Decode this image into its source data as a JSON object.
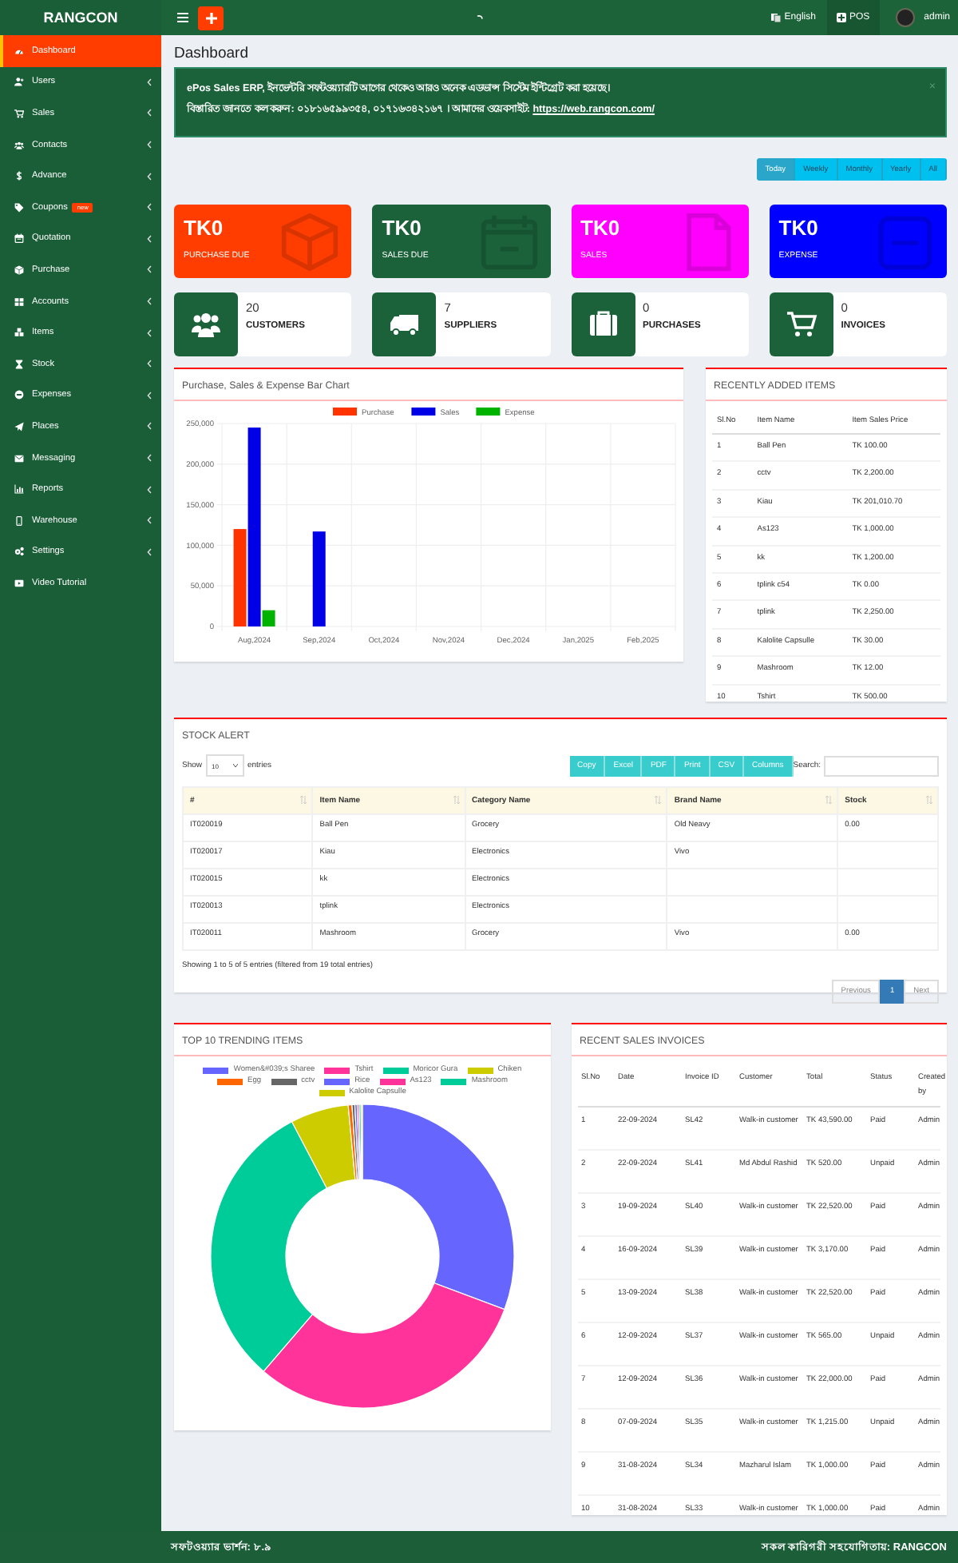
{
  "header": {
    "brand": "RANGCON",
    "language": "English",
    "pos_label": "POS",
    "user": "admin"
  },
  "sidebar": {
    "items": [
      {
        "label": "Dashboard",
        "selected": true,
        "has_submenu": false
      },
      {
        "label": "Users",
        "selected": false,
        "has_submenu": true
      },
      {
        "label": "Sales",
        "selected": false,
        "has_submenu": true
      },
      {
        "label": "Contacts",
        "selected": false,
        "has_submenu": true
      },
      {
        "label": "Advance",
        "selected": false,
        "has_submenu": true
      },
      {
        "label": "Coupons",
        "selected": false,
        "has_submenu": true,
        "badge": "new"
      },
      {
        "label": "Quotation",
        "selected": false,
        "has_submenu": true
      },
      {
        "label": "Purchase",
        "selected": false,
        "has_submenu": true
      },
      {
        "label": "Accounts",
        "selected": false,
        "has_submenu": true
      },
      {
        "label": "Items",
        "selected": false,
        "has_submenu": true
      },
      {
        "label": "Stock",
        "selected": false,
        "has_submenu": true
      },
      {
        "label": "Expenses",
        "selected": false,
        "has_submenu": true
      },
      {
        "label": "Places",
        "selected": false,
        "has_submenu": true
      },
      {
        "label": "Messaging",
        "selected": false,
        "has_submenu": true
      },
      {
        "label": "Reports",
        "selected": false,
        "has_submenu": true
      },
      {
        "label": "Warehouse",
        "selected": false,
        "has_submenu": true
      },
      {
        "label": "Settings",
        "selected": false,
        "has_submenu": true
      },
      {
        "label": "Video Tutorial",
        "selected": false,
        "has_submenu": false
      }
    ]
  },
  "page_title": "Dashboard",
  "notice": {
    "line_1": "ePos Sales ERP, ইনভেন্টরি সফটওয়্যারটি আগের থেকেও আরও অনেক এডভান্স সিস্টেম ইন্টিগ্রেট করা হয়েছে।",
    "line_2": "বিস্তারিত জানতে কল করুন: ০১৮১৬৫৯৯৩৫৪, ০১৭১৬৩৪২১৬৭ । আমাদের ওয়েবসাইট:",
    "link": "https://web.rangcon.com/",
    "close": "×"
  },
  "period_buttons": [
    {
      "label": "Today",
      "selected": true
    },
    {
      "label": "Weekly",
      "selected": false
    },
    {
      "label": "Monthly",
      "selected": false
    },
    {
      "label": "Yearly",
      "selected": false
    },
    {
      "label": "All",
      "selected": false
    }
  ],
  "stat_cards": [
    {
      "amount": "TK0",
      "label": "PURCHASE DUE",
      "color": "#ff3d00"
    },
    {
      "amount": "TK0",
      "label": "SALES DUE",
      "color": "#1b623a"
    },
    {
      "amount": "TK0",
      "label": "SALES",
      "color": "#ff00ff"
    },
    {
      "amount": "TK0",
      "label": "EXPENSE",
      "color": "#0000ff"
    }
  ],
  "info_cards": [
    {
      "count": "20",
      "label": "CUSTOMERS"
    },
    {
      "count": "7",
      "label": "SUPPLIERS"
    },
    {
      "count": "0",
      "label": "PURCHASES"
    },
    {
      "count": "0",
      "label": "INVOICES"
    }
  ],
  "bar_chart": {
    "title": "Purchase, Sales & Expense Bar Chart",
    "chart_data": {
      "type": "bar",
      "categories": [
        "Aug,2024",
        "Sep,2024",
        "Oct,2024",
        "Nov,2024",
        "Dec,2024",
        "Jan,2025",
        "Feb,2025"
      ],
      "series": [
        {
          "name": "Purchase",
          "color": "#ff3300",
          "values": [
            120000,
            0,
            0,
            0,
            0,
            0,
            0
          ]
        },
        {
          "name": "Sales",
          "color": "#0000e6",
          "values": [
            245000,
            117000,
            0,
            0,
            0,
            0,
            0
          ]
        },
        {
          "name": "Expense",
          "color": "#00b300",
          "values": [
            20000,
            0,
            0,
            0,
            0,
            0,
            0
          ]
        }
      ],
      "ylim": [
        0,
        250000
      ],
      "grid": true,
      "legend": true,
      "yticks": [
        {
          "value": 0,
          "label": "0"
        },
        {
          "value": 50000,
          "label": "50,000"
        },
        {
          "value": 100000,
          "label": "100,000"
        },
        {
          "value": 150000,
          "label": "150,000"
        },
        {
          "value": 200000,
          "label": "200,000"
        },
        {
          "value": 250000,
          "label": "250,000"
        }
      ]
    }
  },
  "recent_items": {
    "title": "RECENTLY ADDED ITEMS",
    "columns": [
      "Sl.No",
      "Item Name",
      "Item Sales Price"
    ],
    "rows": [
      [
        "1",
        "Ball Pen",
        "TK 100.00"
      ],
      [
        "2",
        "cctv",
        "TK 2,200.00"
      ],
      [
        "3",
        "Kiau",
        "TK 201,010.70"
      ],
      [
        "4",
        "As123",
        "TK 1,000.00"
      ],
      [
        "5",
        "kk",
        "TK 1,200.00"
      ],
      [
        "6",
        "tplink c54",
        "TK 0.00"
      ],
      [
        "7",
        "tplink",
        "TK 2,250.00"
      ],
      [
        "8",
        "Kalolite Capsulle",
        "TK 30.00"
      ],
      [
        "9",
        "Mashroom",
        "TK 12.00"
      ],
      [
        "10",
        "Tshirt",
        "TK 500.00"
      ]
    ]
  },
  "stock_alert": {
    "title": "STOCK ALERT",
    "show_label": "Show",
    "page_size": "10",
    "entries_label": "entries",
    "buttons": [
      "Copy",
      "Excel",
      "PDF",
      "Print",
      "CSV",
      "Columns"
    ],
    "search_label": "Search:",
    "columns": [
      "#",
      "Item Name",
      "Category Name",
      "Brand Name",
      "Stock"
    ],
    "rows": [
      {
        "code": "IT020019",
        "item": "Ball Pen",
        "category": "Grocery",
        "brand": "Old Neavy",
        "stock": "0.00"
      },
      {
        "code": "IT020017",
        "item": "Kiau",
        "category": "Electronics",
        "brand": "Vivo"
      },
      {
        "code": "IT020015",
        "item": "kk",
        "category": "Electronics"
      },
      {
        "code": "IT020013",
        "item": "tplink",
        "category": "Electronics"
      },
      {
        "code": "IT020011",
        "item": "Mashroom",
        "category": "Grocery",
        "brand": "Vivo",
        "stock": "0.00"
      }
    ],
    "info": "Showing 1 to 5 of 5 entries (filtered from 19 total entries)",
    "pagination": [
      {
        "label": "Previous",
        "selected": false
      },
      {
        "label": "1",
        "selected": true
      },
      {
        "label": "Next",
        "selected": false
      }
    ]
  },
  "trending": {
    "title": "TOP 10 TRENDING ITEMS",
    "legend": [
      {
        "label": "Women&#039;s Sharee",
        "color": "#6666ff"
      },
      {
        "label": "Tshirt",
        "color": "#ff3399"
      },
      {
        "label": "Moricor Gura",
        "color": "#00cc99"
      },
      {
        "label": "Chiken",
        "color": "#cccc00"
      },
      {
        "label": "Egg",
        "color": "#ff6600"
      },
      {
        "label": "cctv",
        "color": "#666666"
      },
      {
        "label": "Rice",
        "color": "#6666ff"
      },
      {
        "label": "As123",
        "color": "#ff3399"
      },
      {
        "label": "Mashroom",
        "color": "#00cc99"
      },
      {
        "label": "Kalolite Capsulle",
        "color": "#cccc00"
      }
    ]
  },
  "invoices": {
    "title": "RECENT SALES INVOICES",
    "columns": [
      "Sl.No",
      "Date",
      "Invoice ID",
      "Customer",
      "Total",
      "Status",
      "Created by"
    ],
    "rows": [
      [
        "1",
        "22-09-2024",
        "SL42",
        "Walk-in customer",
        "TK 43,590.00",
        "Paid",
        "Admin"
      ],
      [
        "2",
        "22-09-2024",
        "SL41",
        "Md Abdul Rashid",
        "TK 520.00",
        "Unpaid",
        "Admin"
      ],
      [
        "3",
        "19-09-2024",
        "SL40",
        "Walk-in customer",
        "TK 22,520.00",
        "Paid",
        "Admin"
      ],
      [
        "4",
        "16-09-2024",
        "SL39",
        "Walk-in customer",
        "TK 3,170.00",
        "Paid",
        "Admin"
      ],
      [
        "5",
        "13-09-2024",
        "SL38",
        "Walk-in customer",
        "TK 22,520.00",
        "Paid",
        "Admin"
      ],
      [
        "6",
        "12-09-2024",
        "SL37",
        "Walk-in customer",
        "TK 565.00",
        "Unpaid",
        "Admin"
      ],
      [
        "7",
        "12-09-2024",
        "SL36",
        "Walk-in customer",
        "TK 22,000.00",
        "Paid",
        "Admin"
      ],
      [
        "8",
        "07-09-2024",
        "SL35",
        "Walk-in customer",
        "TK 1,215.00",
        "Unpaid",
        "Admin"
      ],
      [
        "9",
        "31-08-2024",
        "SL34",
        "Mazharul Islam",
        "TK 1,000.00",
        "Paid",
        "Admin"
      ],
      [
        "10",
        "31-08-2024",
        "SL33",
        "Walk-in customer",
        "TK 1,000.00",
        "Paid",
        "Admin"
      ]
    ]
  },
  "footer": {
    "version": "সফটওয়্যার ভার্শন: ৮.৯",
    "credit": "সকল কারিগরী সহযোগিতায়:",
    "credit_brand": "RANGCON"
  }
}
